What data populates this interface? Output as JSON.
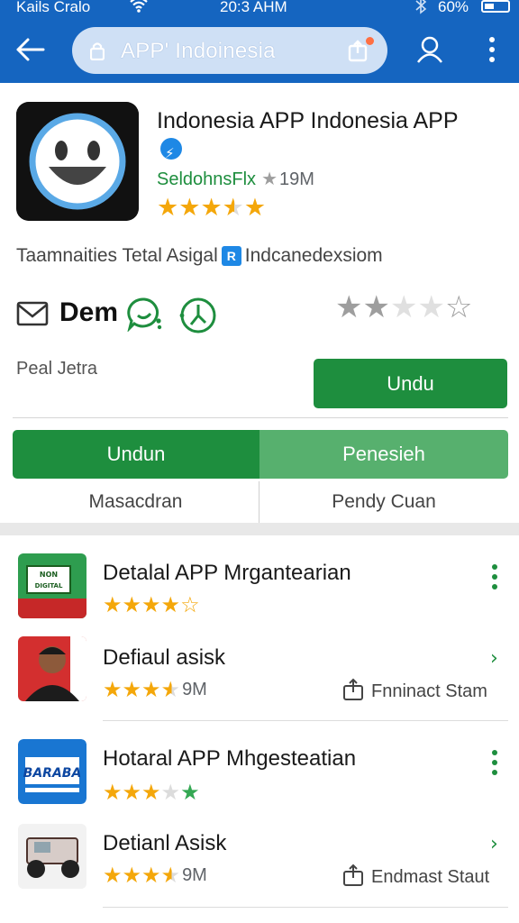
{
  "status_bar": {
    "carrier": "Kails Cralo",
    "time": "20:3 AHM",
    "battery": "60%"
  },
  "app_bar": {
    "url": "APP' Indoinesia"
  },
  "app": {
    "title": "Indonesia APP Indonesia APP",
    "developer": "SeldohnsFlx",
    "downloads": "19M",
    "rating_stars": 3.5,
    "tagline_a": "Taamnaities Tetal Asigal",
    "tagline_icon": "R",
    "tagline_b": "Indcanedexsiom",
    "demo_label": "Dem",
    "user_rating_stars": 2,
    "peal_label": "Peal Jetra",
    "install_label": "Undu"
  },
  "segments": {
    "primary": "Undun",
    "secondary": "Penesieh",
    "sub_primary": "Masacdran",
    "sub_secondary": "Pendy Cuan"
  },
  "colors": {
    "accent_blue": "#1565c0",
    "brand_green": "#1e8e3e",
    "star_gold": "#f4a70a"
  },
  "list": [
    {
      "title": "Detalal APP Mrgantearian",
      "thumb_text": "NON DIGITAL",
      "rating": 4,
      "trailing": "kebab"
    },
    {
      "title": "Defiaul asisk",
      "size": "9M",
      "rating": 3.5,
      "action": "Fnninact Stam",
      "trailing": "chevron"
    },
    {
      "title": "Hotaral APP Mhgesteatian",
      "thumb_text": "BARABA",
      "rating": 3,
      "trailing": "kebab"
    },
    {
      "title": "Detianl Asisk",
      "size": "9M",
      "rating": 3.5,
      "action": "Endmast Staut",
      "trailing": "chevron"
    }
  ]
}
